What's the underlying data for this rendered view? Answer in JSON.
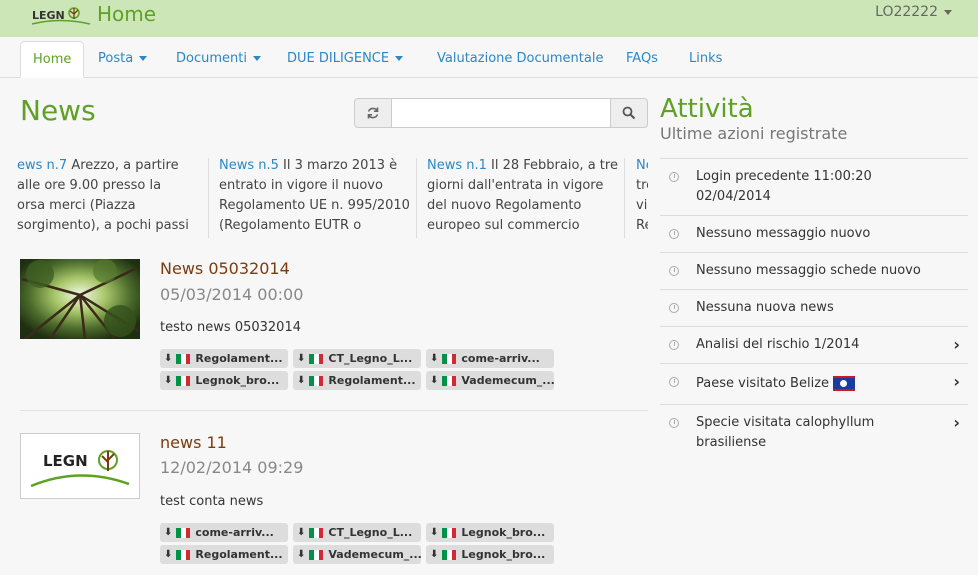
{
  "app": {
    "logo_text": "LEGN",
    "title": "Home",
    "user": "LO22222"
  },
  "nav": [
    {
      "label": "Home",
      "dropdown": false,
      "active": true
    },
    {
      "label": "Posta",
      "dropdown": true
    },
    {
      "label": "Documenti",
      "dropdown": true
    },
    {
      "label": "DUE DILIGENCE",
      "dropdown": true
    },
    {
      "label": "Valutazione Documentale",
      "dropdown": false
    },
    {
      "label": "FAQs",
      "dropdown": false
    },
    {
      "label": "Links",
      "dropdown": false
    }
  ],
  "news": {
    "title": "News",
    "search": {
      "value": "",
      "placeholder": ""
    },
    "ticker": [
      {
        "title": "ews n.7",
        "text": " Arezzo, a partire\nalle ore 9.00 presso la\norsa merci (Piazza\nsorgimento), a pochi passi"
      },
      {
        "title": "News n.5",
        "text": " Il 3 marzo 2013 è\nentrato in vigore il nuovo\nRegolamento UE n. 995/2010\n(Regolamento EUTR o"
      },
      {
        "title": "News n.1",
        "text": " Il 28 Febbraio, a tre\ngiorni dall'entrata in vigore\ndel nuovo Regolamento\neuropeo sul commercio"
      },
      {
        "title": "Ne",
        "text": "\ntre\nvig\nRe"
      }
    ],
    "items": [
      {
        "heading": "News 05032014",
        "date": "05/03/2014 00:00",
        "body": "testo news 05032014",
        "attachments": [
          "Regolament...",
          "CT_Legno_L...",
          "come-arriv...",
          "Legnok_bro...",
          "Regolament...",
          "Vademecum_..."
        ]
      },
      {
        "heading": "news 11",
        "date": "12/02/2014 09:29",
        "body": "test conta news",
        "attachments": [
          "come-arriv...",
          "CT_Legno_L...",
          "Legnok_bro...",
          "Regolament...",
          "Vademecum_...",
          "Legnok_bro..."
        ]
      }
    ]
  },
  "activity": {
    "title": "Attività",
    "subtitle": "Ultime azioni registrate",
    "items": [
      {
        "text": "Login precedente 11:00:20 02/04/2014",
        "chevron": false
      },
      {
        "text": "Nessuno messaggio nuovo",
        "chevron": false
      },
      {
        "text": "Nessuno messaggio schede nuovo",
        "chevron": false
      },
      {
        "text": "Nessuna nuova news",
        "chevron": false
      },
      {
        "text": "Analisi del rischio 1/2014",
        "chevron": true
      },
      {
        "text": "Paese visitato Belize",
        "chevron": true,
        "flag": "belize-flag"
      },
      {
        "text": "Specie visitata calophyllum brasiliense",
        "chevron": true
      }
    ]
  },
  "colors": {
    "accent": "#5fa125",
    "link": "#2a87c8",
    "header_bg": "#cde6b8",
    "heading_brown": "#7a3b10"
  },
  "icons": {
    "refresh": "refresh-icon",
    "search": "search-icon",
    "download": "download-icon",
    "flag": "italy-flag-icon",
    "clock": "clock-icon",
    "chevron": "chevron-right-icon"
  }
}
